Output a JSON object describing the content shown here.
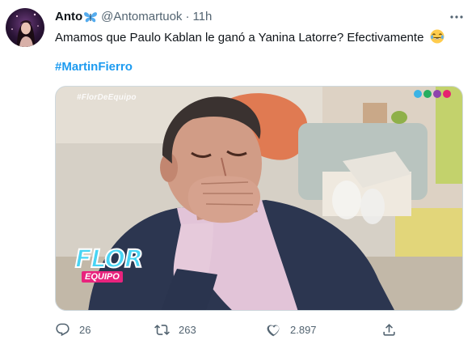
{
  "tweet": {
    "display_name": "Anto",
    "handle": "@Antomartuok",
    "time": "11h",
    "separator": "·",
    "text": "Amamos que Paulo Kablan le ganó a Yanina Latorre? Efectivamente",
    "hashtag": "#MartinFierro"
  },
  "media": {
    "watermark": "#FlorDeEquipo",
    "logo_main": "FLOR",
    "logo_sub": "EQUIPO"
  },
  "actions": {
    "reply_count": "26",
    "retweet_count": "263",
    "like_count": "2.897"
  },
  "colors": {
    "link": "#1d9bf0",
    "secondary_text": "#536471",
    "primary_text": "#0f1419"
  },
  "icons": [
    "avatar",
    "butterfly-emoji-icon",
    "more-options-icon",
    "laughing-emoji-icon",
    "reply-icon",
    "retweet-icon",
    "like-icon",
    "share-icon"
  ]
}
